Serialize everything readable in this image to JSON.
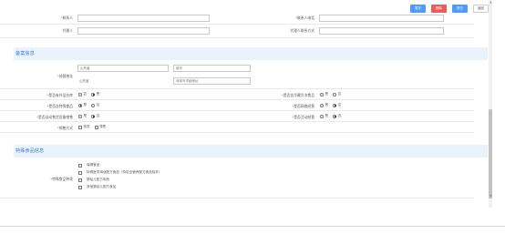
{
  "toolbar": {
    "save": "暂存",
    "delete": "删除",
    "submit": "提交",
    "back": "返回"
  },
  "contact": {
    "contact_label": "联系人",
    "contact_phone_label": "联系人电话",
    "agent_label": "代理人",
    "agent_contact_label": "代理人联系方式"
  },
  "filing": {
    "section_title": "备案信息",
    "address_label": "经营地址",
    "province": "山东省",
    "city_placeholder": "城市",
    "district": "山东省",
    "detail_placeholder": "请填写详细地址",
    "warehouse_label": "是否有外设仓库",
    "cold_label": "是否含冷藏冷冻食品",
    "special_label": "是否含特殊食品",
    "network_label": "是否网络经营",
    "vending_label": "是否自动售货设备销售",
    "event_label": "是否活动经营",
    "sales_label": "销售方式",
    "opt_no": "否",
    "opt_yes": "是",
    "opt_wholesale": "批发",
    "opt_retail": "零售"
  },
  "special_food": {
    "section_title": "特殊食品信息",
    "types_label": "特殊食品种类",
    "types": [
      "保健食品",
      "特殊医学用途配方食品（特定全营养配方食品除外）",
      "婴幼儿配方乳粉",
      "其他婴幼儿配方食品"
    ]
  },
  "colors": {
    "accent": "#3d7fd8",
    "danger": "#f25a5a",
    "primary": "#4d9bff",
    "section_bg": "#eaf3fc"
  }
}
